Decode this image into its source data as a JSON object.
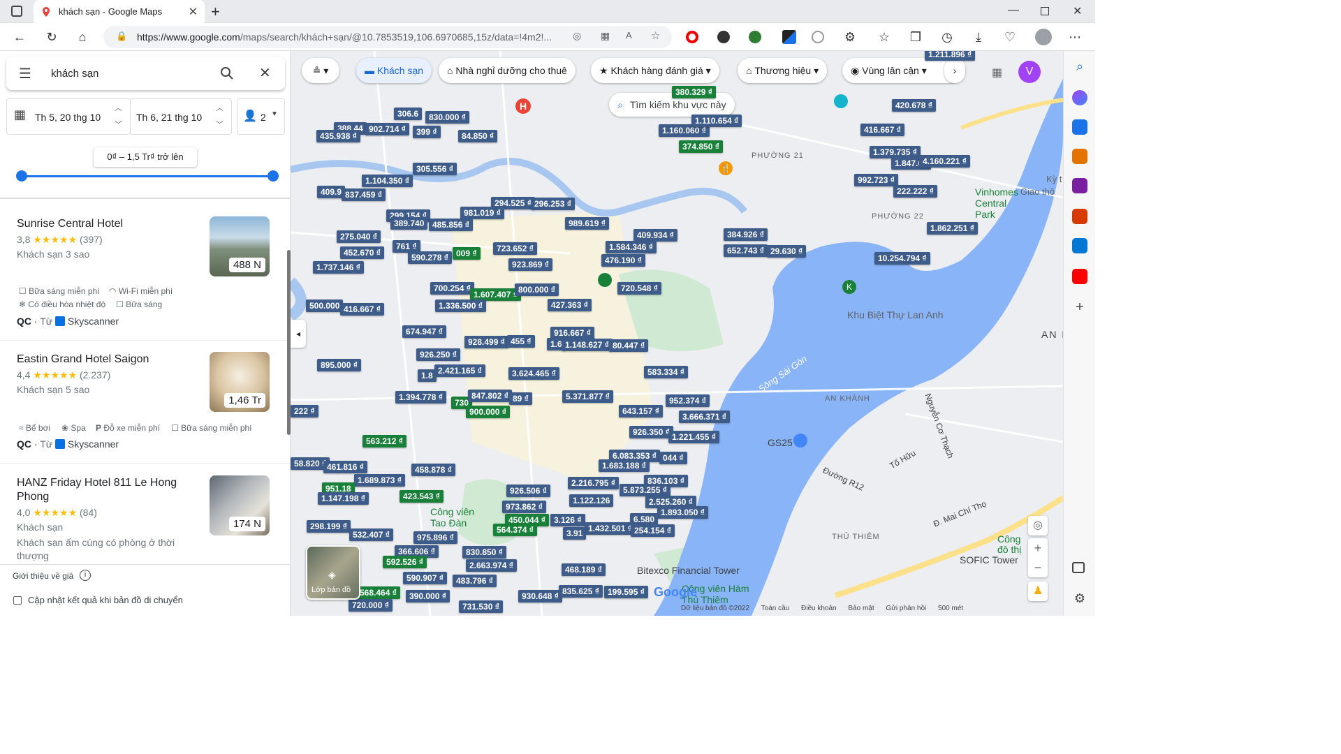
{
  "browser": {
    "tab_title": "khách sạn - Google Maps",
    "url_prefix": "https://www.google.com",
    "url_rest": "/maps/search/khách+sạn/@10.7853519,106.6970685,15z/data=!4m2!..."
  },
  "search": {
    "query": "khách sạn",
    "checkin": "Th 5, 20 thg 10",
    "checkout": "Th 6, 21 thg 10",
    "guests": "2",
    "price_range": "0₫ – 1,5 Tr₫ trở lên"
  },
  "hotels": [
    {
      "name": "Sunrise Central Hotel",
      "rating": "3,8",
      "stars": "★★★★★",
      "reviews": "(397)",
      "type": "Khách sạn 3 sao",
      "price": "488 N",
      "amenities": [
        "Bữa sáng miễn phí",
        "Wi-Fi miễn phí",
        "Có điều hòa nhiệt độ",
        "Bữa sáng"
      ],
      "ad": "QC",
      "from": "Từ",
      "provider": "Skyscanner"
    },
    {
      "name": "Eastin Grand Hotel Saigon",
      "rating": "4,4",
      "stars": "★★★★★",
      "reviews": "(2.237)",
      "type": "Khách sạn 5 sao",
      "price": "1,46 Tr",
      "amenities": [
        "Bể bơi",
        "Spa",
        "Đỗ xe miễn phí",
        "Bữa sáng miễn phí"
      ],
      "ad": "QC",
      "from": "Từ",
      "provider": "Skyscanner"
    },
    {
      "name": "HANZ Friday Hotel 811 Le Hong Phong",
      "rating": "4,0",
      "stars": "★★★★★",
      "reviews": "(84)",
      "type": "Khách sạn",
      "description": "Khách sạn ấm cúng có phòng ở thời thượng",
      "price": "174 N"
    }
  ],
  "panel_footer": {
    "price_info": "Giới thiệu về giá",
    "update_checkbox": "Cập nhật kết quả khi bản đồ di chuyển"
  },
  "map": {
    "chips": [
      "Khách sạn",
      "Nhà nghỉ dưỡng cho thuê",
      "Khách hàng đánh giá",
      "Thương hiệu",
      "Vùng lân cận"
    ],
    "search_area": "Tìm kiếm khu vực này",
    "layer_button": "Lớp bản đồ",
    "avatar_letter": "V",
    "labels": {
      "phuong21": "PHƯỜNG 21",
      "phuong22": "PHƯỜNG 22",
      "ankhanh": "AN KHÁNH",
      "thuthiem": "THỦ THIÊM",
      "vinhomes": "Vinhomes Central Park",
      "kbt": "Khu Biệt Thự Lan Anh",
      "bitexco": "Bitexco Financial Tower",
      "sofic": "SOFIC Tower",
      "congvien": "Công viên Tao Đàn",
      "congvienham": "Công viên Hàm Thủ Thiêm",
      "gs25": "GS25",
      "song": "Sông Sài Gòn",
      "maichitho": "Đ. Mai Chí Thọ",
      "nguyencothach": "Nguyễn Cơ Thạch",
      "tohuu": "Tố Hữu",
      "r12": "Đường R12",
      "an": "AN K",
      "giaotho": "Giao thô",
      "kyt": "Kỳ t",
      "congdothi": "Công đô thị"
    },
    "footer": [
      "Dữ liệu bản đồ ©2022",
      "Toàn cầu",
      "Điều khoản",
      "Bảo mật",
      "Gửi phản hồi",
      "500 mét"
    ],
    "prices": [
      {
        "t": "830.000 ₫"
      },
      {
        "t": "306.6"
      },
      {
        "t": "388.44"
      },
      {
        "t": "902.714 ₫"
      },
      {
        "t": "399 ₫"
      },
      {
        "t": "435.938 ₫"
      },
      {
        "t": "84.850 ₫"
      },
      {
        "t": "305.556 ₫"
      },
      {
        "t": "1.104.350 ₫"
      },
      {
        "t": "409.9"
      },
      {
        "t": "837.459 ₫"
      },
      {
        "t": "294.525 ₫"
      },
      {
        "t": "296.253 ₫"
      },
      {
        "t": "299.154 ₫"
      },
      {
        "t": "981.019 ₫"
      },
      {
        "t": "389.740"
      },
      {
        "t": "485.856 ₫"
      },
      {
        "t": "989.619 ₫"
      },
      {
        "t": "275.040 ₫"
      },
      {
        "t": "761 ₫"
      },
      {
        "t": "452.670 ₫"
      },
      {
        "t": "590.278 ₫"
      },
      {
        "t": "009 ₫",
        "g": true
      },
      {
        "t": "723.652 ₫"
      },
      {
        "t": "1.737.146 ₫"
      },
      {
        "t": "923.869 ₫"
      },
      {
        "t": "700.254 ₫"
      },
      {
        "t": "1.607.407 ₫",
        "g": true
      },
      {
        "t": "800.000 ₫"
      },
      {
        "t": "500.000"
      },
      {
        "t": "416.667 ₫"
      },
      {
        "t": "1.336.500 ₫"
      },
      {
        "t": "427.363 ₫"
      },
      {
        "t": "674.947 ₫"
      },
      {
        "t": "916.667 ₫"
      },
      {
        "t": "928.499 ₫"
      },
      {
        "t": "455 ₫"
      },
      {
        "t": "1.6"
      },
      {
        "t": "1.148.627 ₫"
      },
      {
        "t": "80.447 ₫"
      },
      {
        "t": "895.000 ₫"
      },
      {
        "t": "926.250 ₫"
      },
      {
        "t": "2.421.165 ₫"
      },
      {
        "t": "1.8"
      },
      {
        "t": "3.624.465 ₫"
      },
      {
        "t": "1.394.778 ₫"
      },
      {
        "t": "730",
        "g": true
      },
      {
        "t": "847.802 ₫"
      },
      {
        "t": "89 ₫"
      },
      {
        "t": "900.000 ₫",
        "g": true
      },
      {
        "t": "5.371.877 ₫"
      },
      {
        "t": "563.212 ₫",
        "g": true
      },
      {
        "t": "458.878 ₫"
      },
      {
        "t": "58.820 ₫"
      },
      {
        "t": "461.816 ₫"
      },
      {
        "t": "1.689.873 ₫"
      },
      {
        "t": "951.18",
        "g": true
      },
      {
        "t": "423.543 ₫",
        "g": true
      },
      {
        "t": "1.147.198 ₫"
      },
      {
        "t": "926.506 ₫"
      },
      {
        "t": "2.216.795 ₫"
      },
      {
        "t": "973.862 ₫"
      },
      {
        "t": "1.122.126"
      },
      {
        "t": "298.199 ₫"
      },
      {
        "t": "450.044 ₫",
        "g": true
      },
      {
        "t": "3.126 ₫"
      },
      {
        "t": "564.374 ₫",
        "g": true
      },
      {
        "t": "532.407 ₫"
      },
      {
        "t": "975.896 ₫"
      },
      {
        "t": "1.432.501 ₫"
      },
      {
        "t": "3.91"
      },
      {
        "t": "366.606 ₫"
      },
      {
        "t": "830.850 ₫"
      },
      {
        "t": "592.526 ₫",
        "g": true
      },
      {
        "t": "2.663.974 ₫"
      },
      {
        "t": "590.907 ₫"
      },
      {
        "t": "483.796 ₫"
      },
      {
        "t": "390.000 ₫"
      },
      {
        "t": "568.464 ₫",
        "g": true
      },
      {
        "t": "720.000 ₫"
      },
      {
        "t": "731.530 ₫"
      },
      {
        "t": "930.648 ₫"
      },
      {
        "t": "835.625 ₫"
      },
      {
        "t": "199.595 ₫"
      },
      {
        "t": "468.189 ₫"
      },
      {
        "t": "1.160.060 ₫"
      },
      {
        "t": "374.850 ₫",
        "g": true
      },
      {
        "t": "380.329 ₫",
        "g": true
      },
      {
        "t": "1.110.654 ₫"
      },
      {
        "t": "409.934 ₫"
      },
      {
        "t": "1.584.346 ₫"
      },
      {
        "t": "476.190 ₫"
      },
      {
        "t": "720.548 ₫"
      },
      {
        "t": "384.926 ₫"
      },
      {
        "t": "652.743 ₫"
      },
      {
        "t": "29.630 ₫"
      },
      {
        "t": "420.678 ₫"
      },
      {
        "t": "416.667 ₫"
      },
      {
        "t": "1.379.735 ₫"
      },
      {
        "t": "1.847.02"
      },
      {
        "t": "4.160.221 ₫"
      },
      {
        "t": "992.723 ₫"
      },
      {
        "t": "222.222 ₫"
      },
      {
        "t": "1.862.251 ₫"
      },
      {
        "t": "10.254.794 ₫"
      },
      {
        "t": "583.334 ₫"
      },
      {
        "t": "952.374 ₫"
      },
      {
        "t": "643.157 ₫"
      },
      {
        "t": "3.666.371 ₫"
      },
      {
        "t": "926.350 ₫"
      },
      {
        "t": "1.221.455 ₫"
      },
      {
        "t": "6.083.353 ₫"
      },
      {
        "t": "044 ₫"
      },
      {
        "t": "1.683.188 ₫"
      },
      {
        "t": "836.103 ₫"
      },
      {
        "t": "5.873.255 ₫"
      },
      {
        "t": "2.525.260 ₫"
      },
      {
        "t": "1.893.050 ₫"
      },
      {
        "t": "6.580"
      },
      {
        "t": "254.154 ₫"
      },
      {
        "t": "1.211.896 ₫"
      },
      {
        "t": "222 ₫"
      }
    ]
  }
}
